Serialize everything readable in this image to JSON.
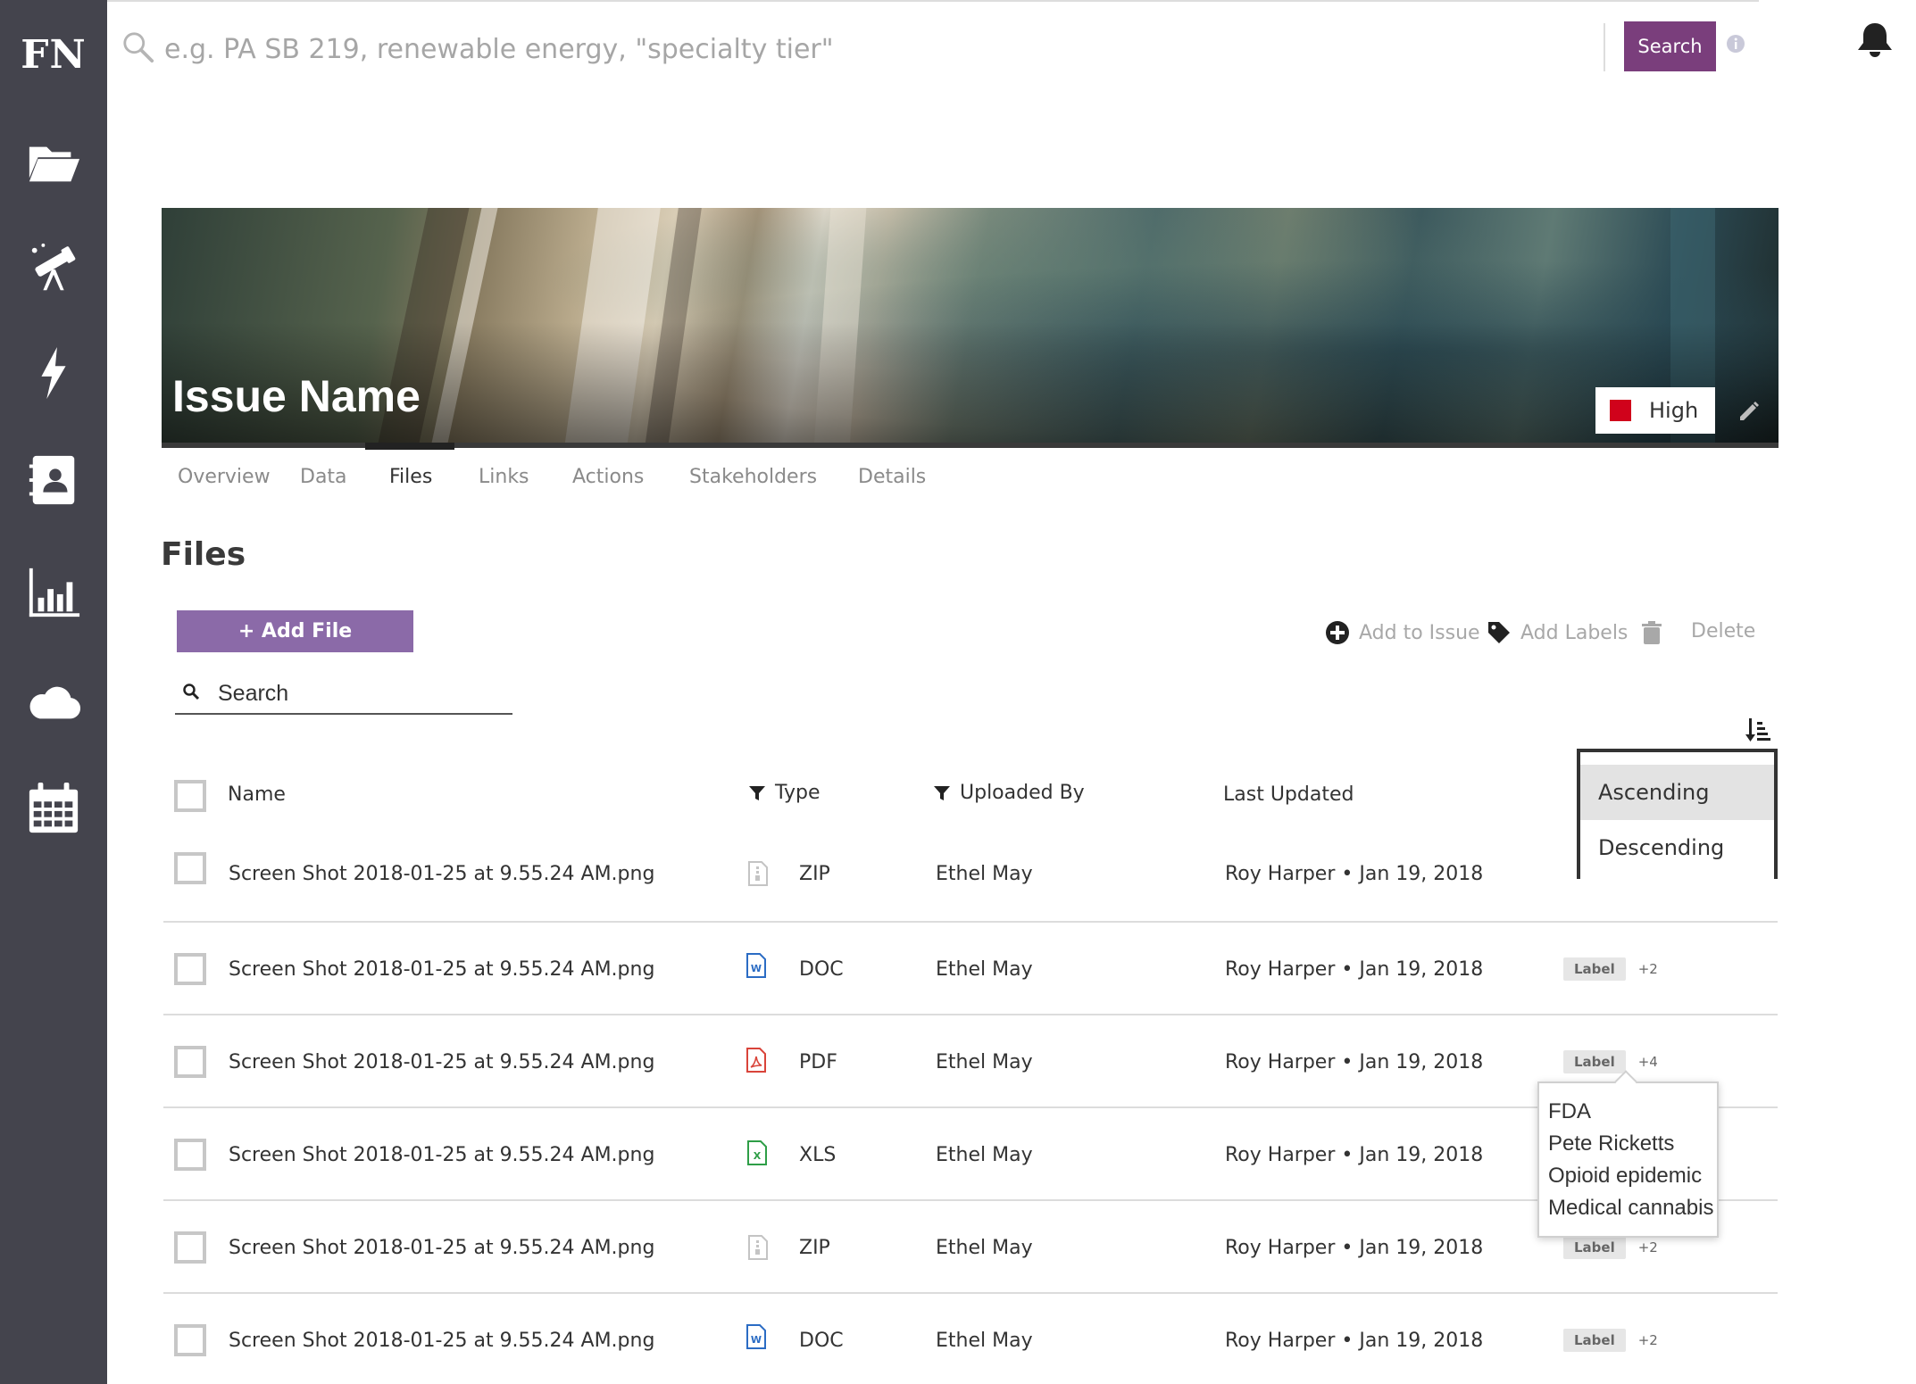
{
  "brand": {
    "logo_text": "FN"
  },
  "sidebar": {
    "items": [
      {
        "icon": "folder-open-icon"
      },
      {
        "icon": "telescope-icon"
      },
      {
        "icon": "lightning-icon"
      },
      {
        "icon": "contacts-book-icon"
      },
      {
        "icon": "bar-chart-icon"
      },
      {
        "icon": "cloud-icon"
      },
      {
        "icon": "calendar-icon"
      }
    ]
  },
  "topbar": {
    "search_placeholder": "e.g. PA SB 219, renewable energy, \"specialty tier\"",
    "search_value": "",
    "search_button": "Search",
    "accent": "#7a3e7c"
  },
  "issue": {
    "name": "Issue Name",
    "priority": "High",
    "priority_color": "#d0021b"
  },
  "tabs": [
    {
      "label": "Overview",
      "active": false
    },
    {
      "label": "Data",
      "active": false
    },
    {
      "label": "Files",
      "active": true
    },
    {
      "label": "Links",
      "active": false
    },
    {
      "label": "Actions",
      "active": false
    },
    {
      "label": "Stakeholders",
      "active": false
    },
    {
      "label": "Details",
      "active": false
    }
  ],
  "files": {
    "title": "Files",
    "add_button": "+ Add File",
    "actions": {
      "add_to_issue": "Add to Issue",
      "add_labels": "Add Labels",
      "delete": "Delete"
    },
    "search_placeholder": "Search",
    "columns": {
      "name": "Name",
      "type": "Type",
      "uploaded_by": "Uploaded By",
      "last_updated": "Last Updated"
    },
    "rows": [
      {
        "name": "Screen Shot 2018-01-25 at 9.55.24 AM.png",
        "type": "ZIP",
        "type_icon": "zip-file-icon",
        "uploaded_by": "Ethel May",
        "last_updated": "Roy Harper • Jan 19, 2018",
        "label": "",
        "label_more": ""
      },
      {
        "name": "Screen Shot 2018-01-25 at 9.55.24 AM.png",
        "type": "DOC",
        "type_icon": "word-file-icon",
        "uploaded_by": "Ethel May",
        "last_updated": "Roy Harper • Jan 19, 2018",
        "label": "Label",
        "label_more": "+2"
      },
      {
        "name": "Screen Shot 2018-01-25 at 9.55.24 AM.png",
        "type": "PDF",
        "type_icon": "pdf-file-icon",
        "uploaded_by": "Ethel May",
        "last_updated": "Roy Harper • Jan 19, 2018",
        "label": "Label",
        "label_more": "+4"
      },
      {
        "name": "Screen Shot 2018-01-25 at 9.55.24 AM.png",
        "type": "XLS",
        "type_icon": "excel-file-icon",
        "uploaded_by": "Ethel May",
        "last_updated": "Roy Harper • Jan 19, 2018",
        "label": "",
        "label_more": ""
      },
      {
        "name": "Screen Shot 2018-01-25 at 9.55.24 AM.png",
        "type": "ZIP",
        "type_icon": "zip-file-icon",
        "uploaded_by": "Ethel May",
        "last_updated": "Roy Harper • Jan 19, 2018",
        "label": "Label",
        "label_more": "+2"
      },
      {
        "name": "Screen Shot 2018-01-25 at 9.55.24 AM.png",
        "type": "DOC",
        "type_icon": "word-file-icon",
        "uploaded_by": "Ethel May",
        "last_updated": "Roy Harper • Jan 19, 2018",
        "label": "Label",
        "label_more": "+2"
      }
    ],
    "sort_menu": {
      "options": [
        "Ascending",
        "Descending"
      ],
      "selected": "Ascending"
    },
    "label_popover": [
      "FDA",
      "Pete Ricketts",
      "Opioid epidemic",
      "Medical cannabis"
    ]
  }
}
